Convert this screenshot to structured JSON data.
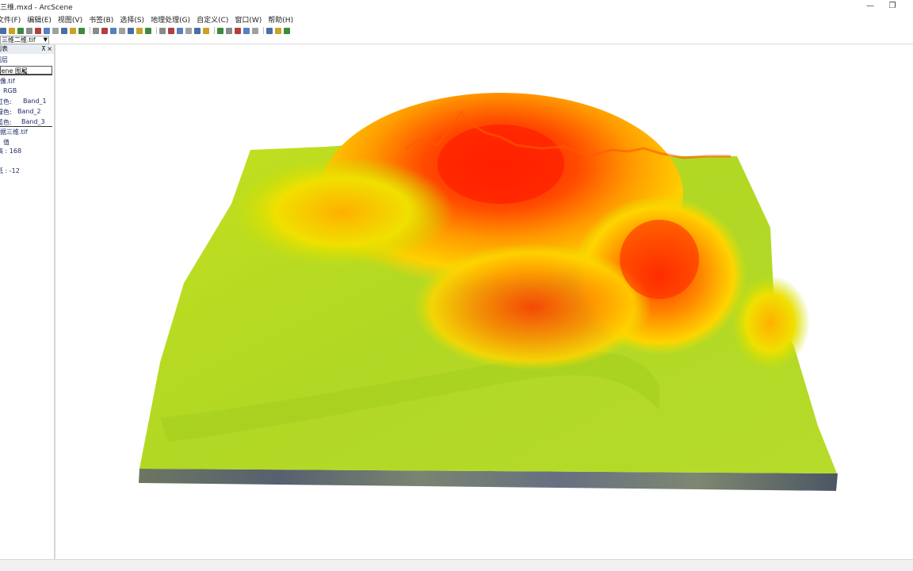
{
  "window": {
    "title": "三维.mxd - ArcScene",
    "minimize": "—",
    "restore": "❐"
  },
  "menu": {
    "items": [
      "文件(F)",
      "编辑(E)",
      "视图(V)",
      "书签(B)",
      "选择(S)",
      "地理处理(G)",
      "自定义(C)",
      "窗口(W)",
      "帮助(H)"
    ]
  },
  "toolbar": {
    "icons": [
      "new-icon",
      "open-icon",
      "save-icon",
      "print-icon",
      "cut-icon",
      "copy-icon",
      "paste-icon",
      "delete-icon",
      "undo-icon",
      "redo-icon",
      "add-data-icon",
      "scene-properties-icon",
      "layer-properties-icon",
      "catalog-icon",
      "toolbox-icon",
      "python-icon",
      "model-icon",
      "navigate-icon",
      "fly-icon",
      "zoom-in-icon",
      "zoom-out-icon",
      "pan-icon",
      "full-extent-icon",
      "select-icon",
      "identify-icon",
      "measure-icon",
      "find-icon",
      "swipe-icon",
      "globe-icon",
      "animation-icon",
      "export-icon"
    ]
  },
  "layer_selector": {
    "value": "三维二维.tif"
  },
  "toc": {
    "header": "内容列表",
    "pin": "⊼",
    "close": "×",
    "root": "图层",
    "scene_layers": "Scene 图层",
    "image_layer": "影像.tif",
    "rgb": "RGB",
    "red": "红色:",
    "red_band": "Band_1",
    "green": "绿色:",
    "green_band": "Band_2",
    "blue": "蓝色:",
    "blue_band": "Band_3",
    "dem_layer": "数据三维.tif",
    "value_label": "值",
    "high": "高 : 168",
    "low": "低 : -12"
  },
  "colors": {
    "high": "#ff2a00",
    "mid": "#ffb000",
    "low": "#b2d926",
    "toc_text": "#1c2b6b"
  }
}
